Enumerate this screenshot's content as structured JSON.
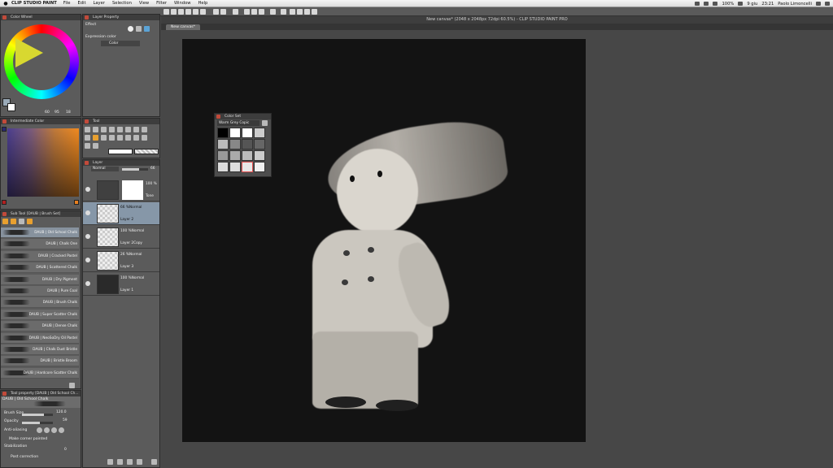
{
  "menubar": {
    "app_name": "CLIP STUDIO PAINT",
    "menus": [
      "File",
      "Edit",
      "Layer",
      "Selection",
      "View",
      "Filter",
      "Window",
      "Help"
    ],
    "battery": "100%",
    "date": "9 giu",
    "time": "23:21",
    "user": "Paolo Limoncelli"
  },
  "document": {
    "title": "New canvas* (2048 x 2048px 72dpi 60.5%) - CLIP STUDIO PAINT PRO",
    "tab_label": "New canvas*"
  },
  "panels": {
    "color_wheel": {
      "title": "Color Wheel",
      "values": [
        "60",
        "95",
        "18"
      ]
    },
    "layer_property": {
      "title": "Layer Property",
      "effect_label": "Effect",
      "expression_label": "Expression color",
      "expression_value": "Color"
    },
    "intermediate_color": {
      "title": "Intermediate Color"
    },
    "sub_tool": {
      "title": "Sub Tool [DAUB | Brush Set]"
    },
    "tool": {
      "title": "Tool"
    },
    "layer": {
      "title": "Layer",
      "blend_mode": "Normal",
      "opacity": "66"
    },
    "tool_property": {
      "title": "Tool property [DAUB | Old School Ch...",
      "brush_name": "DAUB | Old School Chalk",
      "brush_size_label": "Brush Size",
      "brush_size_value": "120.0",
      "opacity_label": "Opacity",
      "opacity_value": "59",
      "anti_aliasing_label": "Anti-aliasing",
      "corner_label": "Make corner pointed",
      "stabilization_label": "Stabilization",
      "stabilization_value": "0",
      "post_correction_label": "Post correction"
    },
    "color_set": {
      "title": "Color Set",
      "set_name": "Warm Grey Copic"
    }
  },
  "brushes": [
    "DAUB | Old School Chalk",
    "DAUB | Chalk One",
    "DAUB | Cracked Pastel",
    "DAUB | Scattered Chalk",
    "DAUB | Dry Pigment",
    "DAUB | Pure Coal",
    "DAUB | Brush Chalk",
    "DAUB | Super Scatter Chalk",
    "DAUB | Dense Chalk",
    "DAUB | NeoSoDry Oil Pastel",
    "DAUB | Chalk Dust Bristle",
    "DAUB | Bristle Broom",
    "DAUB | Hardcore Scatter Chalk"
  ],
  "layers": [
    {
      "mode": "100 %",
      "name": "Tone"
    },
    {
      "mode": "66 %Normal",
      "name": "Layer 2"
    },
    {
      "mode": "100 %Normal",
      "name": "Layer 2Copy"
    },
    {
      "mode": "26 %Normal",
      "name": "Layer 3"
    },
    {
      "mode": "100 %Normal",
      "name": "Layer 1"
    }
  ],
  "color_set_swatches": [
    "#000000",
    "#ffffff",
    "#ffffff",
    "#cccccc",
    "#bbbbbb",
    "#888888",
    "#555555",
    "#666666",
    "#999999",
    "#aaaaaa",
    "#bbbbbb",
    "#cccccc",
    "#dddddd",
    "#dddddd",
    "#e8e8e8",
    "#f0f0f0"
  ],
  "colors": {
    "accent_red": "#c24a3a",
    "canvas_bg": "#131313",
    "selected_row": "#8697a8"
  }
}
